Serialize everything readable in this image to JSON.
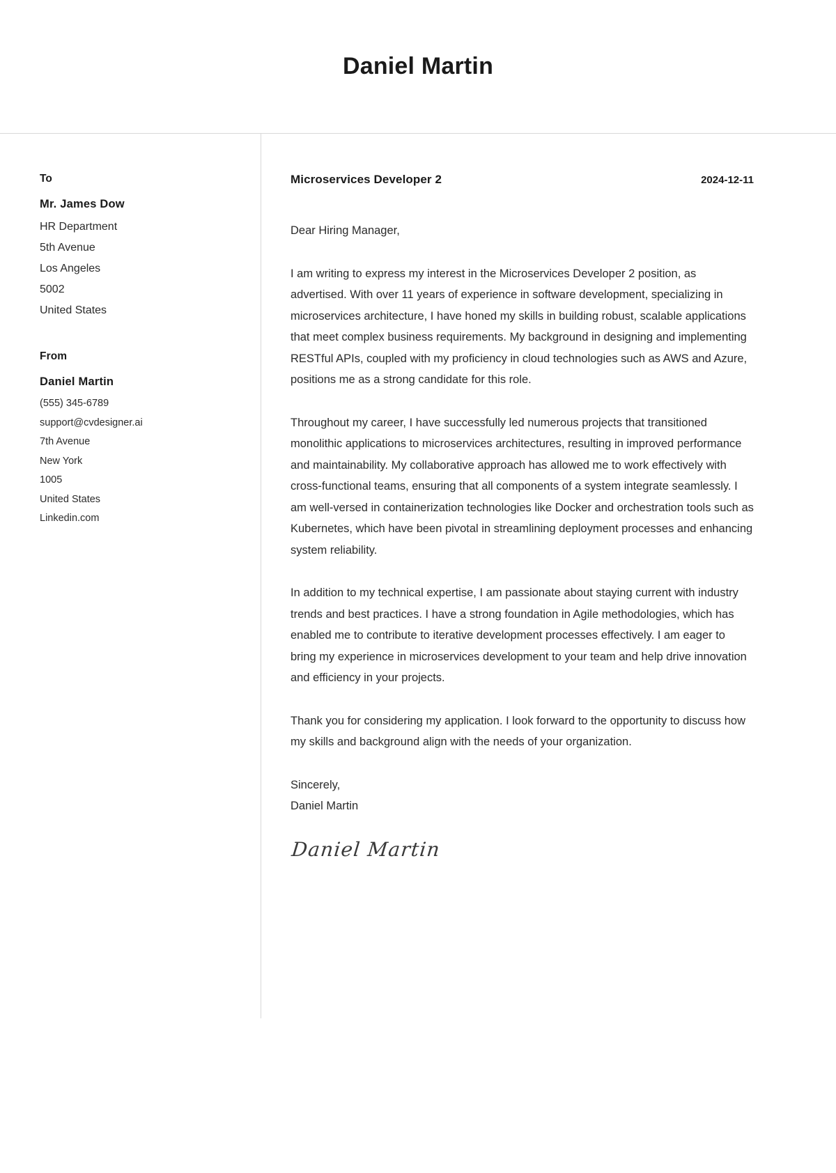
{
  "header": {
    "name": "Daniel Martin"
  },
  "sidebar": {
    "to_label": "To",
    "recipient": {
      "name": "Mr. James Dow",
      "lines": [
        "HR Department",
        "5th Avenue",
        "Los Angeles",
        "5002",
        "United States"
      ]
    },
    "from_label": "From",
    "sender": {
      "name": "Daniel Martin",
      "lines": [
        "(555) 345-6789",
        "support@cvdesigner.ai",
        "7th Avenue",
        "New York",
        "1005",
        "United States",
        "Linkedin.com"
      ]
    }
  },
  "letter": {
    "job_title": "Microservices Developer 2",
    "date": "2024-12-11",
    "salutation": "Dear Hiring Manager,",
    "paragraphs": [
      "I am writing to express my interest in the Microservices Developer 2 position, as advertised. With over 11 years of experience in software development, specializing in microservices architecture, I have honed my skills in building robust, scalable applications that meet complex business requirements. My background in designing and implementing RESTful APIs, coupled with my proficiency in cloud technologies such as AWS and Azure, positions me as a strong candidate for this role.",
      "Throughout my career, I have successfully led numerous projects that transitioned monolithic applications to microservices architectures, resulting in improved performance and maintainability. My collaborative approach has allowed me to work effectively with cross-functional teams, ensuring that all components of a system integrate seamlessly. I am well-versed in containerization technologies like Docker and orchestration tools such as Kubernetes, which have been pivotal in streamlining deployment processes and enhancing system reliability.",
      "In addition to my technical expertise, I am passionate about staying current with industry trends and best practices. I have a strong foundation in Agile methodologies, which has enabled me to contribute to iterative development processes effectively. I am eager to bring my experience in microservices development to your team and help drive innovation and efficiency in your projects.",
      "Thank you for considering my application. I look forward to the opportunity to discuss how my skills and background align with the needs of your organization."
    ],
    "closing": "Sincerely,",
    "signer_name": "Daniel Martin",
    "signature_text": "Daniel Martin"
  }
}
